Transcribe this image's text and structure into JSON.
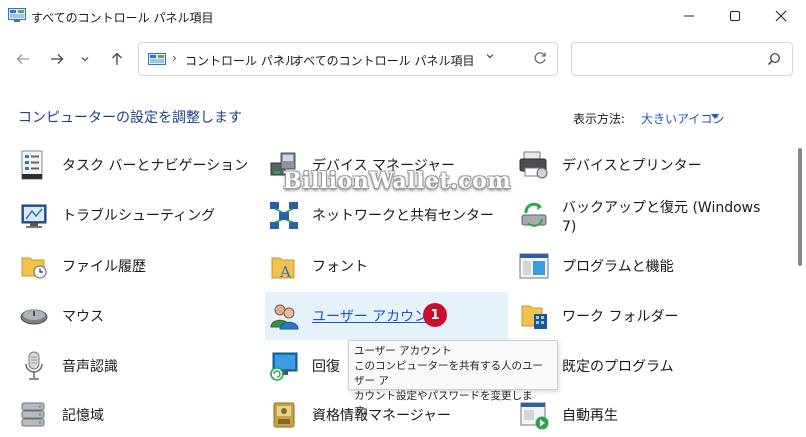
{
  "window": {
    "title": "すべてのコントロール パネル項目",
    "minimize": "minimize",
    "maximize": "maximize",
    "close": "close"
  },
  "nav": {
    "breadcrumbs": [
      "コントロール パネル",
      "すべてのコントロール パネル項目"
    ],
    "search_placeholder": ""
  },
  "header": {
    "title": "コンピューターの設定を調整します",
    "view_by_label": "表示方法:",
    "view_by_value": "大きいアイコン"
  },
  "items": [
    {
      "label": "タスク バーとナビゲーション",
      "icon": "taskbar-icon"
    },
    {
      "label": "デバイス マネージャー",
      "icon": "device-manager-icon"
    },
    {
      "label": "デバイスとプリンター",
      "icon": "printer-icon"
    },
    {
      "label": "トラブルシューティング",
      "icon": "troubleshoot-icon"
    },
    {
      "label": "ネットワークと共有センター",
      "icon": "network-icon"
    },
    {
      "label": "バックアップと復元 (Windows",
      "label2": "7)",
      "icon": "backup-icon"
    },
    {
      "label": "ファイル履歴",
      "icon": "file-history-icon"
    },
    {
      "label": "フォント",
      "icon": "font-icon"
    },
    {
      "label": "プログラムと機能",
      "icon": "programs-icon"
    },
    {
      "label": "マウス",
      "icon": "mouse-icon"
    },
    {
      "label": "ユーザー アカウント",
      "icon": "user-accounts-icon"
    },
    {
      "label": "ワーク フォルダー",
      "icon": "work-folders-icon"
    },
    {
      "label": "音声認識",
      "icon": "microphone-icon"
    },
    {
      "label": "回復",
      "icon": "recovery-icon"
    },
    {
      "label": "既定のプログラム",
      "icon": "default-programs-icon"
    },
    {
      "label": "記憶域",
      "icon": "storage-icon"
    },
    {
      "label": "資格情報マネージャー",
      "icon": "credential-icon"
    },
    {
      "label": "自動再生",
      "icon": "autoplay-icon"
    }
  ],
  "tooltip": {
    "title": "ユーザー アカウント",
    "line1": "このコンピューターを共有する人のユーザー ア",
    "line2": "カウント設定やパスワードを変更します。"
  },
  "badge": "1",
  "watermark": "BillionWallet.com",
  "colors": {
    "accent": "#1e55c7",
    "badge": "#c8102e",
    "hover": "#e5f1fb"
  }
}
